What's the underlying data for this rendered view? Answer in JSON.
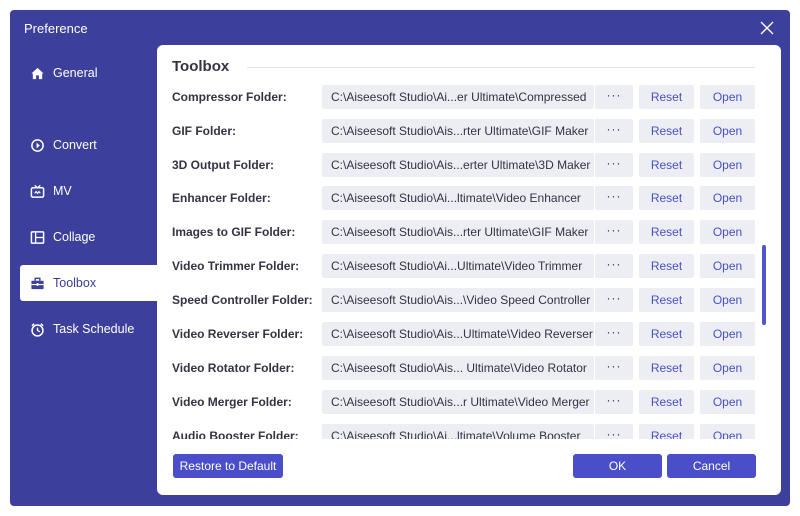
{
  "window": {
    "title": "Preference"
  },
  "sidebar": {
    "items": [
      {
        "label": "General",
        "icon": "home-icon",
        "active": false
      },
      {
        "label": "Convert",
        "icon": "convert-icon",
        "active": false
      },
      {
        "label": "MV",
        "icon": "mv-icon",
        "active": false
      },
      {
        "label": "Collage",
        "icon": "collage-icon",
        "active": false
      },
      {
        "label": "Toolbox",
        "icon": "toolbox-icon",
        "active": true
      },
      {
        "label": "Task Schedule",
        "icon": "clock-icon",
        "active": false
      }
    ]
  },
  "main": {
    "section_title": "Toolbox",
    "dots_label": "···",
    "reset_label": "Reset",
    "open_label": "Open",
    "rows": [
      {
        "label": "Compressor Folder:",
        "path": "C:\\Aiseesoft Studio\\Ai...er Ultimate\\Compressed"
      },
      {
        "label": "GIF Folder:",
        "path": "C:\\Aiseesoft Studio\\Ais...rter Ultimate\\GIF Maker"
      },
      {
        "label": "3D Output Folder:",
        "path": "C:\\Aiseesoft Studio\\Ais...erter Ultimate\\3D Maker"
      },
      {
        "label": "Enhancer Folder:",
        "path": "C:\\Aiseesoft Studio\\Ai...ltimate\\Video Enhancer"
      },
      {
        "label": "Images to GIF Folder:",
        "path": "C:\\Aiseesoft Studio\\Ais...rter Ultimate\\GIF Maker"
      },
      {
        "label": "Video Trimmer Folder:",
        "path": "C:\\Aiseesoft Studio\\Ai...Ultimate\\Video Trimmer"
      },
      {
        "label": "Speed Controller Folder:",
        "path": "C:\\Aiseesoft Studio\\Ais...\\Video Speed Controller"
      },
      {
        "label": "Video Reverser Folder:",
        "path": "C:\\Aiseesoft Studio\\Ais...Ultimate\\Video Reverser"
      },
      {
        "label": "Video Rotator Folder:",
        "path": "C:\\Aiseesoft Studio\\Ais... Ultimate\\Video Rotator"
      },
      {
        "label": "Video Merger Folder:",
        "path": "C:\\Aiseesoft Studio\\Ais...r Ultimate\\Video Merger"
      },
      {
        "label": "Audio Booster Folder:",
        "path": "C:\\Aiseesoft Studio\\Ai...ltimate\\Volume Booster"
      }
    ]
  },
  "footer": {
    "restore_label": "Restore to Default",
    "ok_label": "OK",
    "cancel_label": "Cancel"
  },
  "colors": {
    "frame": "#3c3f9b",
    "accent": "#4a4fc9",
    "field_bg": "#eceef3"
  }
}
